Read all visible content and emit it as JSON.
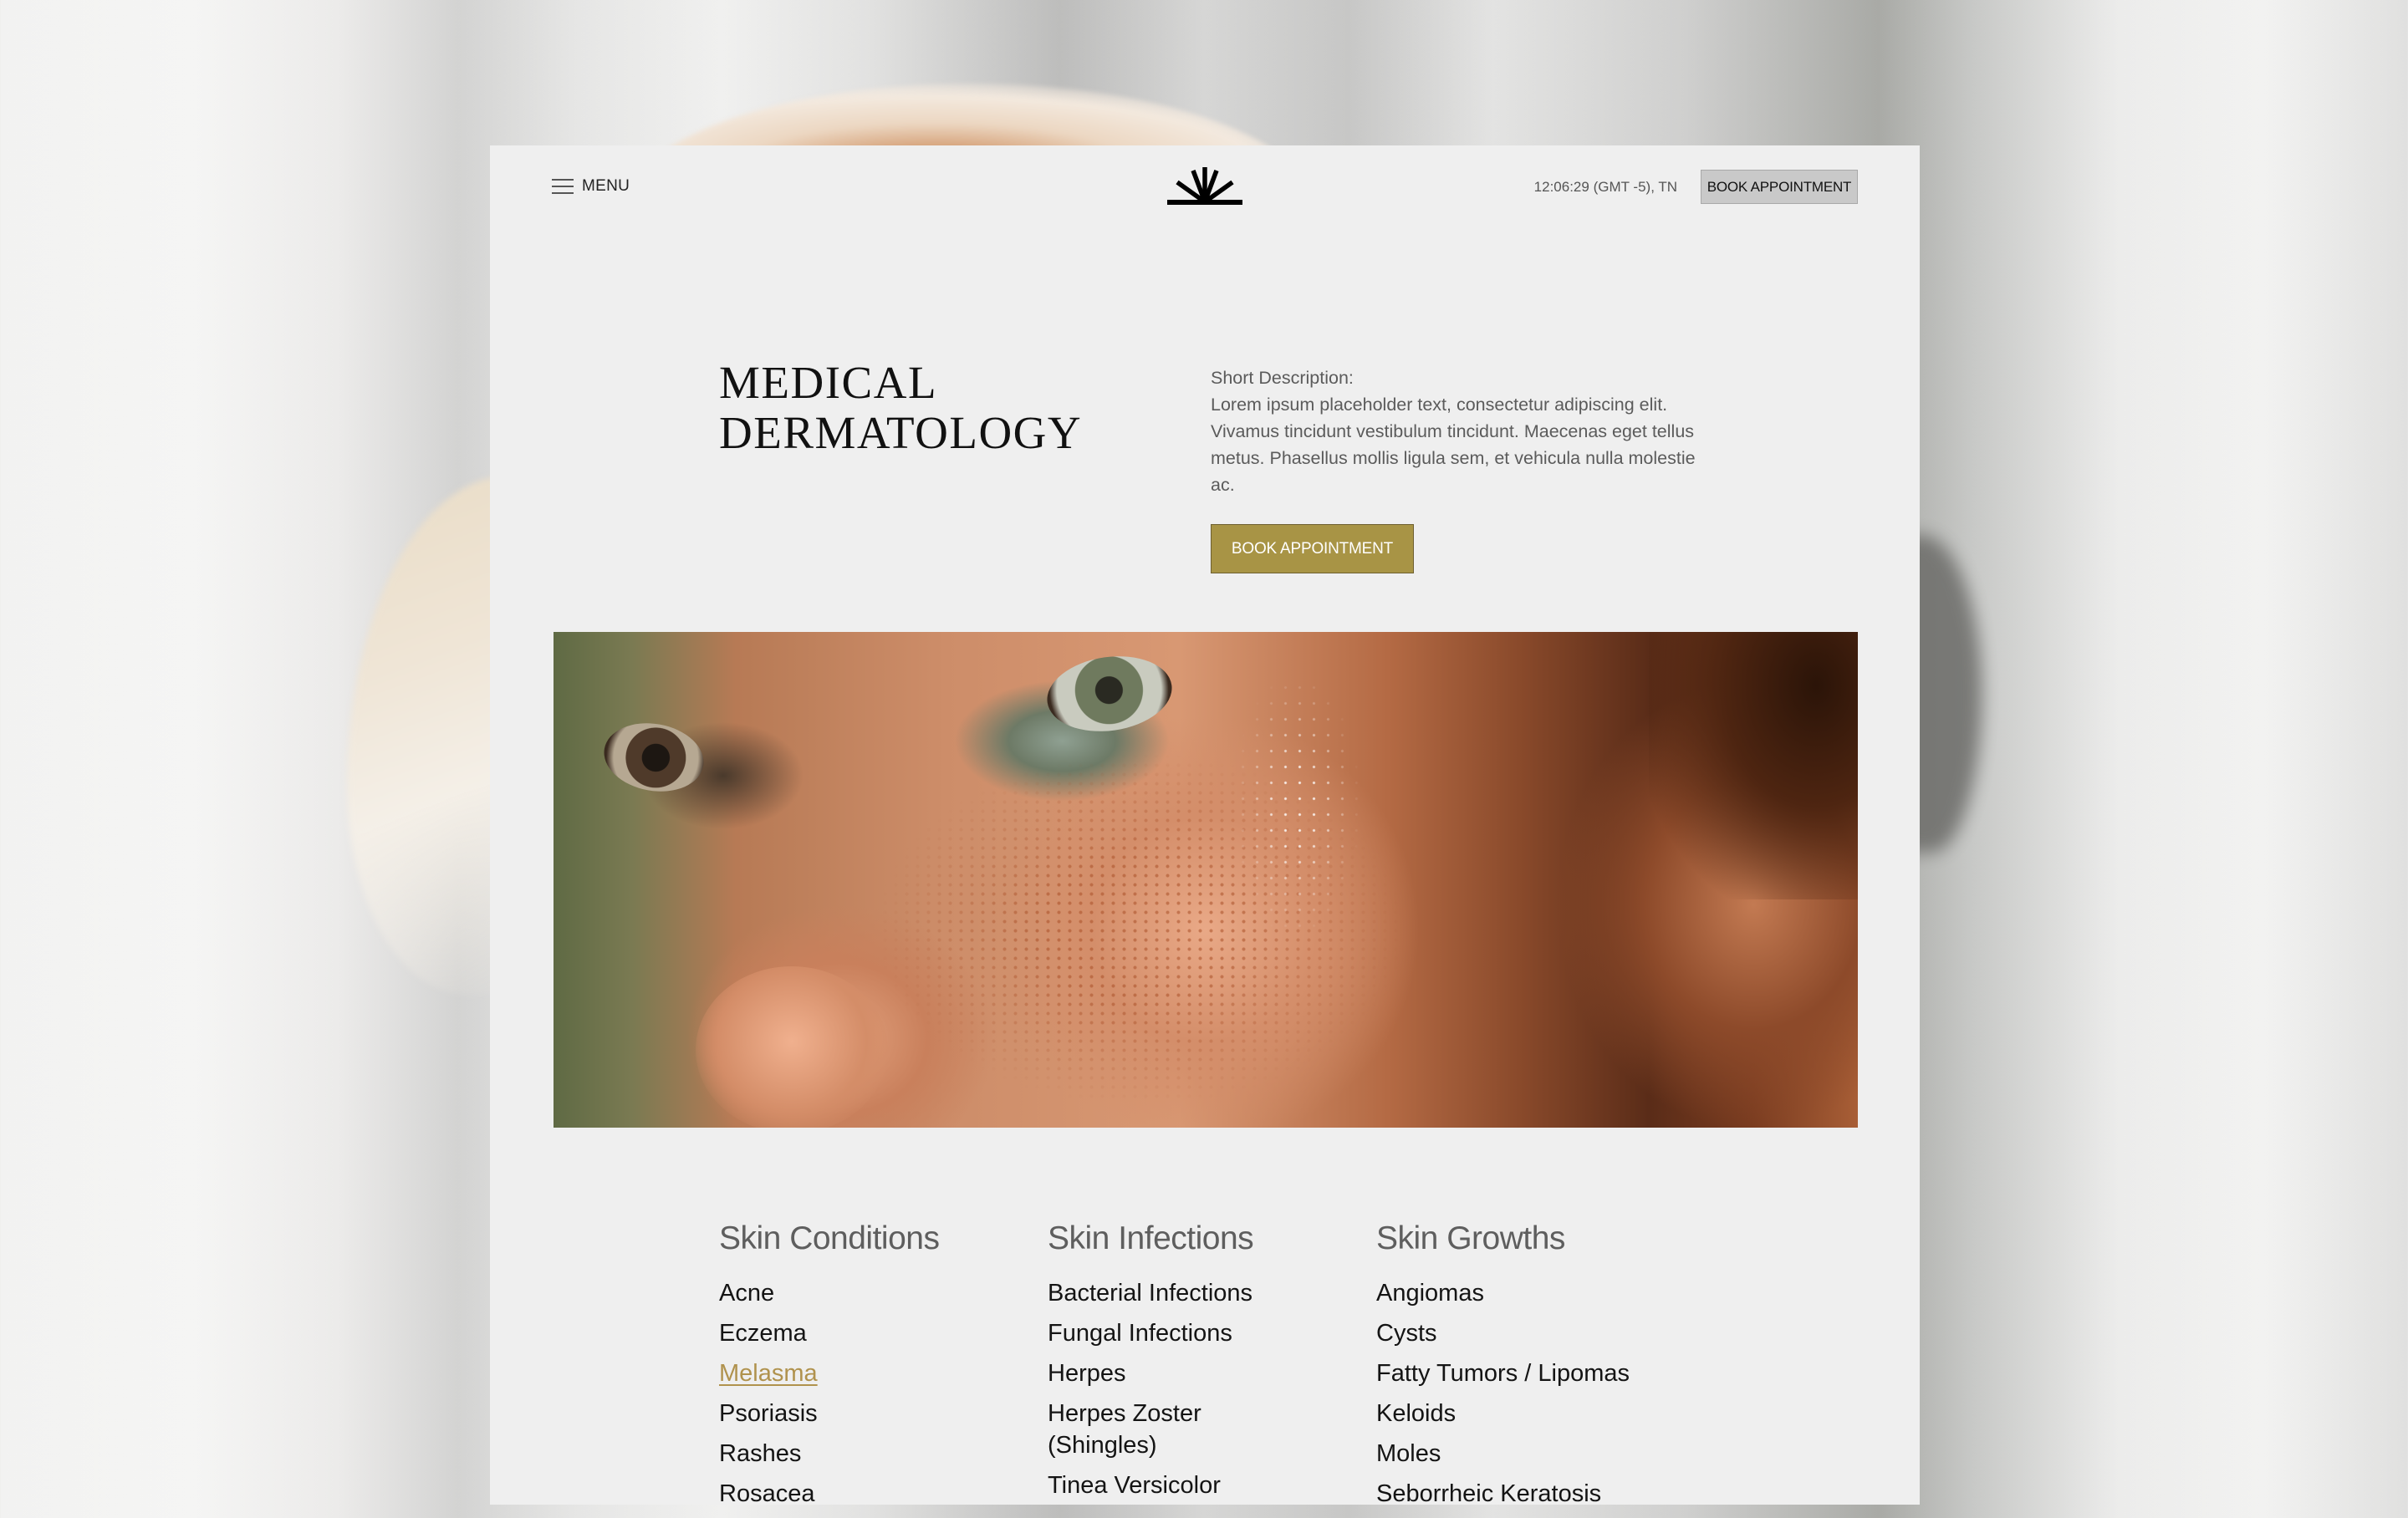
{
  "nav": {
    "menu_label": "MENU",
    "menu_icon": "hamburger-icon",
    "logo_icon": "sunburst-logo-icon",
    "clock": "12:06:29 (GMT -5), TN",
    "book_label": "BOOK APPOINTMENT"
  },
  "hero": {
    "title_line1": "MEDICAL",
    "title_line2": "DERMATOLOGY",
    "description_label": "Short Description:",
    "description": "Lorem ipsum placeholder text, consectetur adipiscing elit. Vivamus tincidunt vestibulum tincidunt. Maecenas eget tellus metus. Phasellus mollis ligula sem, et vehicula nulla molestie ac.",
    "book_label": "BOOK APPOINTMENT",
    "image_alt": "close-up of freckled face"
  },
  "colors": {
    "accent_gold": "#a89445",
    "active_link": "#b0924d",
    "card_bg": "#efefef",
    "nav_button_bg": "#c9c9c9"
  },
  "categories": [
    {
      "heading": "Skin Conditions",
      "items": [
        {
          "label": "Acne",
          "active": false
        },
        {
          "label": "Eczema",
          "active": false
        },
        {
          "label": "Melasma",
          "active": true
        },
        {
          "label": "Psoriasis",
          "active": false
        },
        {
          "label": "Rashes",
          "active": false
        },
        {
          "label": "Rosacea",
          "active": false
        }
      ]
    },
    {
      "heading": "Skin Infections",
      "items": [
        {
          "label": "Bacterial Infections",
          "active": false
        },
        {
          "label": "Fungal Infections",
          "active": false
        },
        {
          "label": "Herpes",
          "active": false
        },
        {
          "label": "Herpes Zoster (Shingles)",
          "active": false
        },
        {
          "label": "Tinea Versicolor",
          "active": false
        }
      ]
    },
    {
      "heading": "Skin Growths",
      "items": [
        {
          "label": "Angiomas",
          "active": false
        },
        {
          "label": "Cysts",
          "active": false
        },
        {
          "label": "Fatty Tumors / Lipomas",
          "active": false
        },
        {
          "label": "Keloids",
          "active": false
        },
        {
          "label": "Moles",
          "active": false
        },
        {
          "label": "Seborrheic Keratosis",
          "active": false
        }
      ]
    }
  ]
}
